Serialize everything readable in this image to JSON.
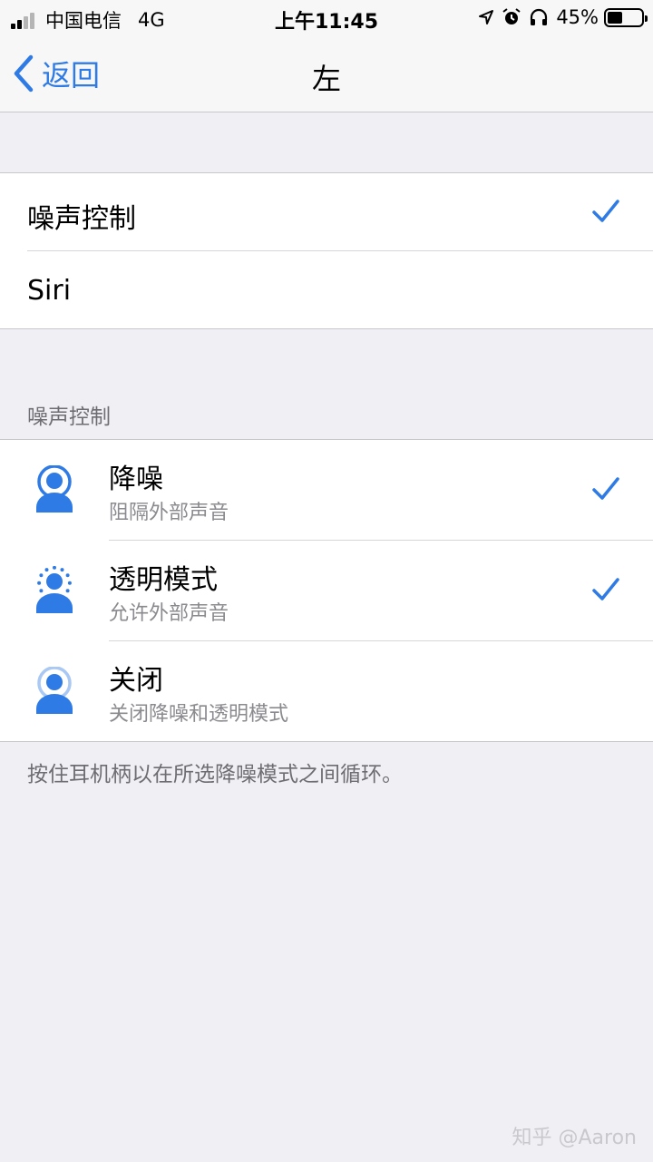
{
  "status_bar": {
    "carrier": "中国电信",
    "network": "4G",
    "time": "上午11:45",
    "battery": "45%",
    "battery_level": 0.45,
    "icons": [
      "signal-icon",
      "location-arrow-icon",
      "alarm-icon",
      "headphones-icon",
      "battery-icon"
    ]
  },
  "nav": {
    "back_label": "返回",
    "title": "左"
  },
  "press_options": [
    {
      "label": "噪声控制",
      "checked": true
    },
    {
      "label": "Siri",
      "checked": false
    }
  ],
  "noise_control": {
    "header": "噪声控制",
    "options": [
      {
        "title": "降噪",
        "subtitle": "阻隔外部声音",
        "checked": true,
        "icon": "noise-cancellation-icon"
      },
      {
        "title": "透明模式",
        "subtitle": "允许外部声音",
        "checked": true,
        "icon": "transparency-icon"
      },
      {
        "title": "关闭",
        "subtitle": "关闭降噪和透明模式",
        "checked": false,
        "icon": "noise-off-icon"
      }
    ],
    "footer": "按住耳机柄以在所选降噪模式之间循环。"
  },
  "watermark": "知乎 @Aaron",
  "colors": {
    "accent": "#2f7be5",
    "background": "#efeff4",
    "secondary_text": "#6d6d72"
  }
}
